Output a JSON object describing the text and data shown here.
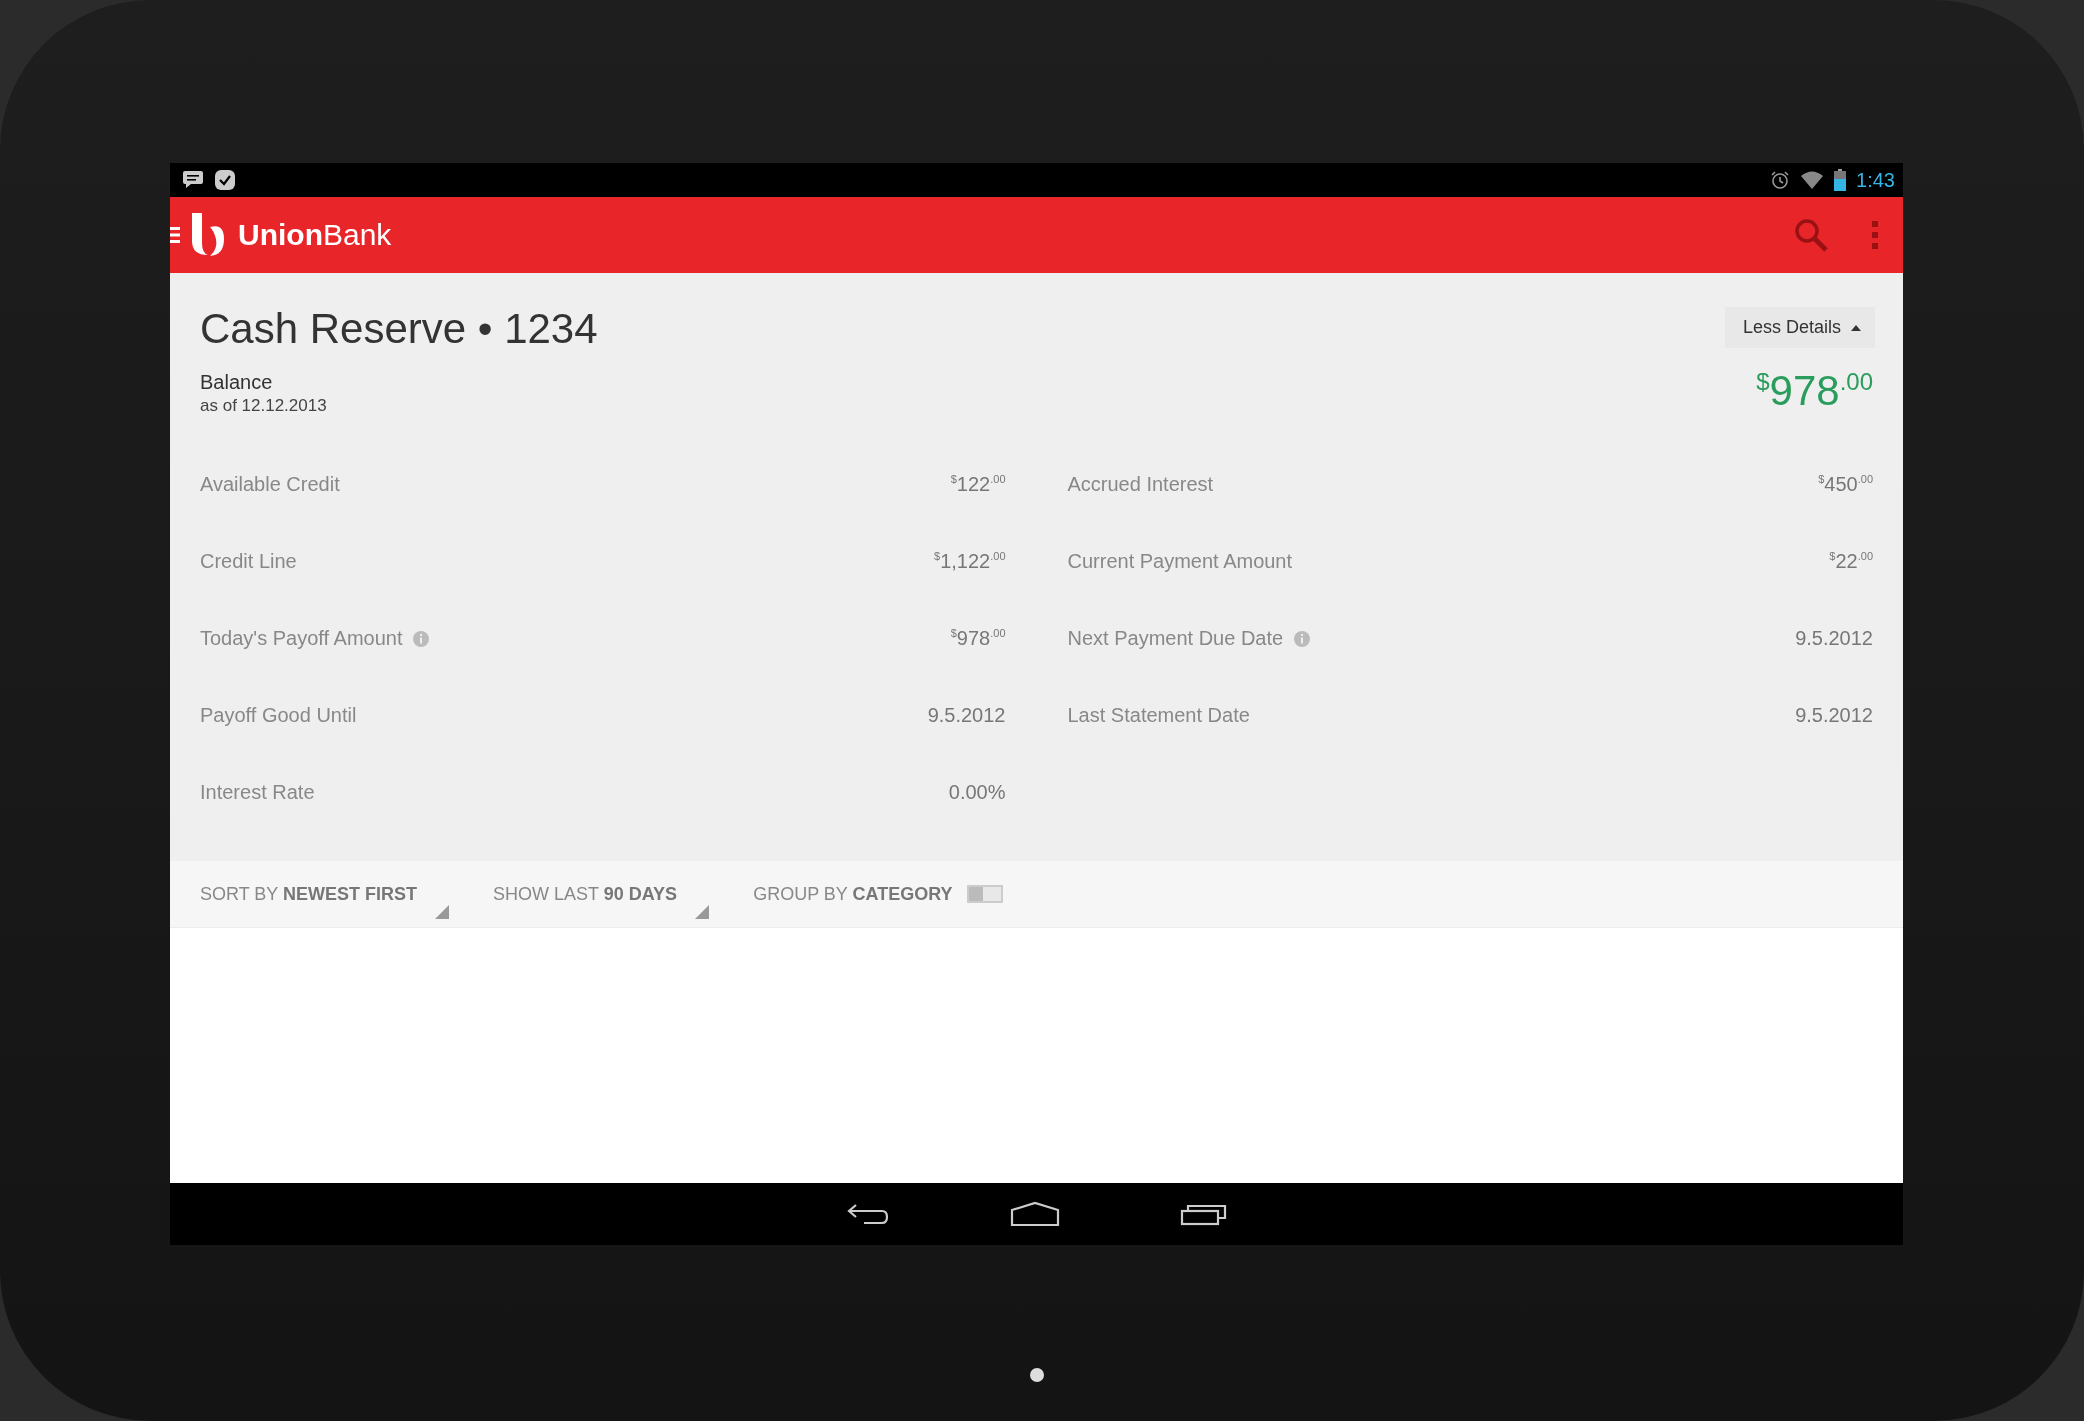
{
  "status_bar": {
    "time": "1:43"
  },
  "app_bar": {
    "brand": "**Union**Bank"
  },
  "account": {
    "title": "Cash Reserve • 1234",
    "balance_label": "Balance",
    "as_of": "as of 12.12.2013",
    "balance": {
      "currency": "$",
      "whole": "978",
      "cents": ".00"
    },
    "details_button": "Less Details",
    "expanded": true
  },
  "details": [
    [
      {
        "label": "Available Credit",
        "info": false,
        "kind": "amount",
        "currency": "$",
        "whole": "122",
        "cents": ".00"
      },
      {
        "label": "Credit Line",
        "info": false,
        "kind": "amount",
        "currency": "$",
        "whole": "1,122",
        "cents": ".00"
      },
      {
        "label": "Today's Payoff Amount",
        "info": true,
        "kind": "amount",
        "currency": "$",
        "whole": "978",
        "cents": ".00"
      },
      {
        "label": "Payoff Good Until",
        "info": false,
        "kind": "text",
        "value": "9.5.2012"
      },
      {
        "label": "Interest Rate",
        "info": false,
        "kind": "text",
        "value": "0.00%"
      }
    ],
    [
      {
        "label": "Accrued Interest",
        "info": false,
        "kind": "amount",
        "currency": "$",
        "whole": "450",
        "cents": ".00"
      },
      {
        "label": "Current Payment Amount",
        "info": false,
        "kind": "amount",
        "currency": "$",
        "whole": "22",
        "cents": ".00"
      },
      {
        "label": "Next Payment Due Date",
        "info": true,
        "kind": "text",
        "value": "9.5.2012"
      },
      {
        "label": "Last Statement Date",
        "info": false,
        "kind": "text",
        "value": "9.5.2012"
      }
    ]
  ],
  "filters": [
    {
      "kind": "dropdown",
      "label": "SORT BY **NEWEST FIRST**"
    },
    {
      "kind": "dropdown",
      "label": "SHOW LAST **90 DAYS**"
    },
    {
      "kind": "toggle",
      "label": "GROUP BY **CATEGORY**",
      "on": false
    }
  ]
}
